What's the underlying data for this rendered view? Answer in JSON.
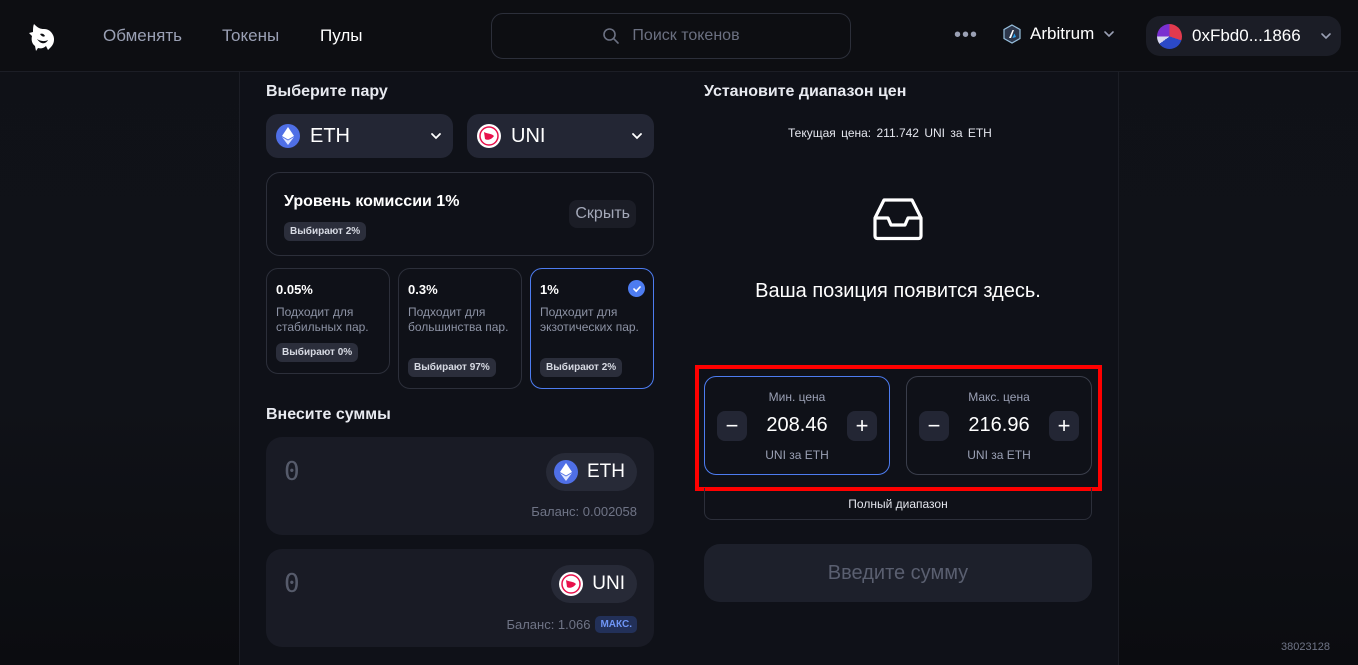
{
  "header": {
    "nav": [
      "Обменять",
      "Токены",
      "Пулы"
    ],
    "search_placeholder": "Поиск токенов",
    "more": "•••",
    "network": "Arbitrum",
    "wallet": "0xFbd0...1866"
  },
  "pair": {
    "title": "Выберите пару",
    "token_a": "ETH",
    "token_b": "UNI"
  },
  "fee": {
    "title": "Уровень комиссии 1%",
    "badge": "Выбирают 2%",
    "hide": "Скрыть",
    "tiers": [
      {
        "pct": "0.05%",
        "desc": "Подходит для стабильных пар.",
        "badge": "Выбирают 0%"
      },
      {
        "pct": "0.3%",
        "desc": "Подходит для большинства пар.",
        "badge": "Выбирают 97%"
      },
      {
        "pct": "1%",
        "desc": "Подходит для экзотических пар.",
        "badge": "Выбирают 2%"
      }
    ]
  },
  "deposit": {
    "title": "Внесите суммы",
    "eth": {
      "value": "0",
      "token": "ETH",
      "balance": "Баланс: 0.002058"
    },
    "uni": {
      "value": "0",
      "token": "UNI",
      "balance": "Баланс: 1.066",
      "max": "МАКС."
    }
  },
  "range": {
    "title": "Установите диапазон цен",
    "current_label": "Текущая цена:",
    "current_value": "211.742",
    "current_unit": "UNI за ETH",
    "empty_text": "Ваша позиция появится здесь.",
    "min": {
      "label": "Мин. цена",
      "value": "208.46",
      "unit": "UNI за ETH"
    },
    "max": {
      "label": "Макс. цена",
      "value": "216.96",
      "unit": "UNI за ETH"
    },
    "step_minus": "−",
    "step_plus": "+",
    "full_range": "Полный диапазон",
    "cta": "Введите сумму"
  },
  "build_id": "38023128"
}
